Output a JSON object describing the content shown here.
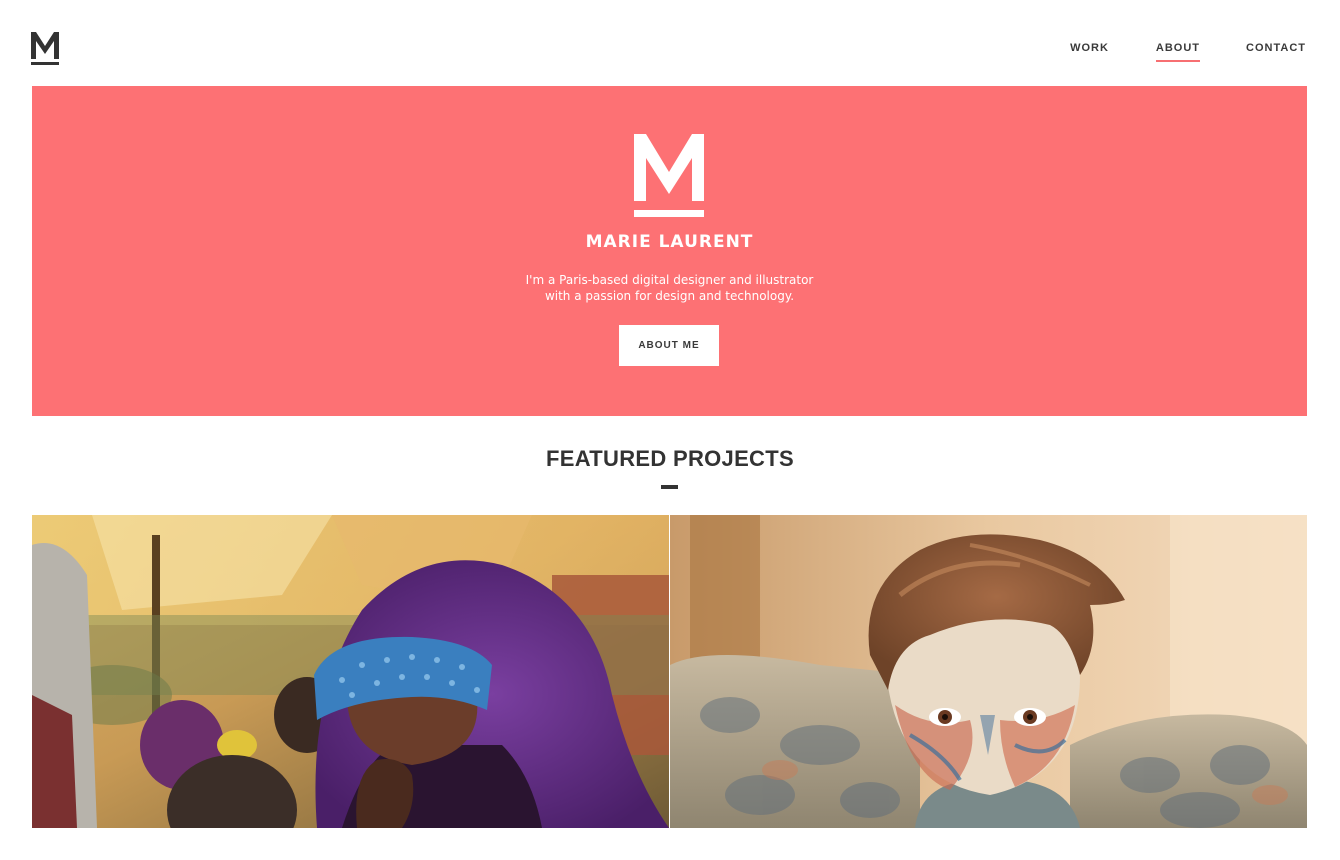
{
  "header": {
    "logo_icon": "m-logo-icon",
    "nav": [
      {
        "label": "WORK",
        "active": false
      },
      {
        "label": "ABOUT",
        "active": true
      },
      {
        "label": "CONTACT",
        "active": false
      }
    ],
    "accent_color": "#f76f72"
  },
  "hero": {
    "background_color": "#fd7174",
    "logo_icon": "m-logo-icon",
    "name": "MARIE LAURENT",
    "description_line1": "I'm a Paris-based digital designer and illustrator",
    "description_line2": "with a passion for design and technology.",
    "button_label": "ABOUT ME"
  },
  "featured": {
    "title": "FEATURED PROJECTS",
    "projects": [
      {
        "image": "woman-in-purple-hijab-photo"
      },
      {
        "image": "child-with-painted-face-photo"
      }
    ]
  }
}
